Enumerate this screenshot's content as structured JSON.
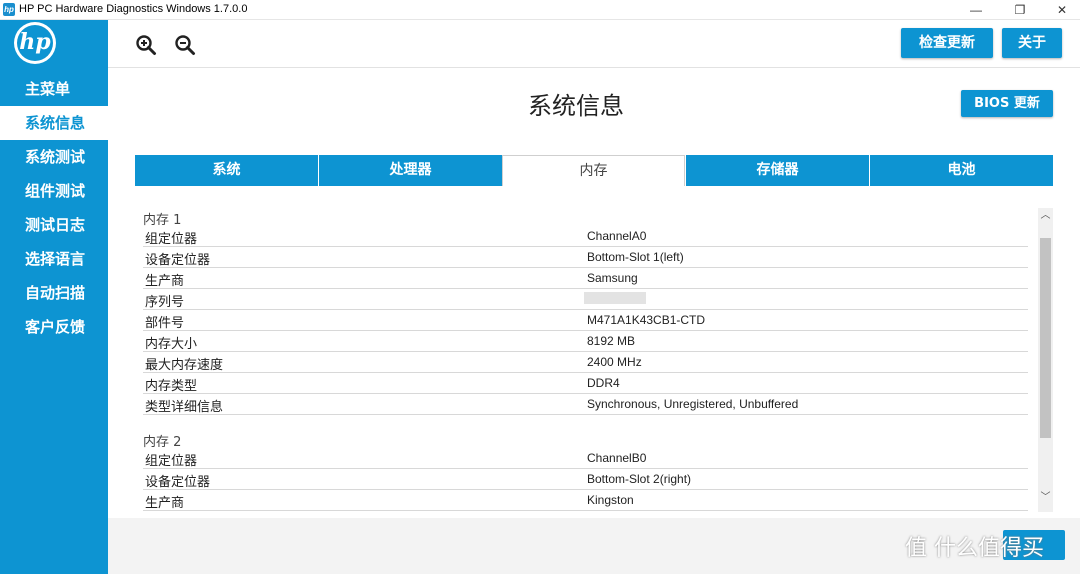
{
  "window": {
    "title": "HP PC Hardware Diagnostics Windows 1.7.0.0",
    "controls": {
      "minimize": "—",
      "maximize": "❐",
      "close": "✕"
    }
  },
  "logo": {
    "text": "hp"
  },
  "sidebar": {
    "items": [
      {
        "label": "主菜单",
        "active": false
      },
      {
        "label": "系统信息",
        "active": true
      },
      {
        "label": "系统测试",
        "active": false
      },
      {
        "label": "组件测试",
        "active": false
      },
      {
        "label": "测试日志",
        "active": false
      },
      {
        "label": "选择语言",
        "active": false
      },
      {
        "label": "自动扫描",
        "active": false
      },
      {
        "label": "客户反馈",
        "active": false
      }
    ]
  },
  "toolbar": {
    "zoom_in_icon": "zoom-in-icon",
    "zoom_out_icon": "zoom-out-icon",
    "check_update_label": "检查更新",
    "about_label": "关于"
  },
  "main": {
    "title": "系统信息",
    "bios_update_label": "BIOS 更新",
    "tabs": [
      {
        "label": "系统",
        "active": false
      },
      {
        "label": "处理器",
        "active": false
      },
      {
        "label": "内存",
        "active": true
      },
      {
        "label": "存储器",
        "active": false
      },
      {
        "label": "电池",
        "active": false
      }
    ],
    "memory": [
      {
        "title": "内存 1",
        "rows": [
          {
            "key": "组定位器",
            "value": "ChannelA0"
          },
          {
            "key": "设备定位器",
            "value": "Bottom-Slot 1(left)"
          },
          {
            "key": "生产商",
            "value": "Samsung"
          },
          {
            "key": "序列号",
            "value": ""
          },
          {
            "key": "部件号",
            "value": "M471A1K43CB1-CTD"
          },
          {
            "key": "内存大小",
            "value": "8192 MB"
          },
          {
            "key": "最大内存速度",
            "value": "2400 MHz"
          },
          {
            "key": "内存类型",
            "value": "DDR4"
          },
          {
            "key": "类型详细信息",
            "value": "Synchronous, Unregistered, Unbuffered"
          }
        ]
      },
      {
        "title": "内存 2",
        "rows": [
          {
            "key": "组定位器",
            "value": "ChannelB0"
          },
          {
            "key": "设备定位器",
            "value": "Bottom-Slot 2(right)"
          },
          {
            "key": "生产商",
            "value": "Kingston"
          }
        ]
      }
    ]
  },
  "watermark": {
    "text": "值 什么值得买"
  }
}
